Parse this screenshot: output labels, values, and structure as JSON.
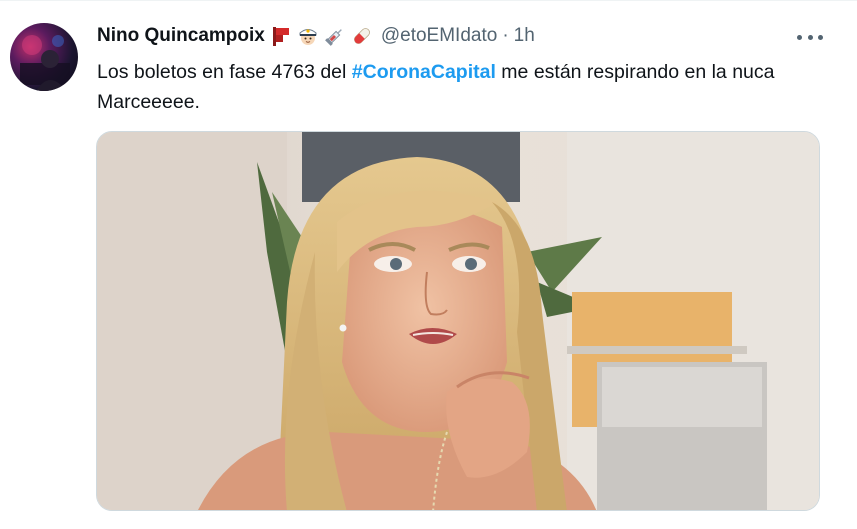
{
  "tweet": {
    "author": {
      "display_name": "Nino Quincampoix",
      "handle": "@etoEMIdato",
      "separator": "·",
      "time": "1h",
      "name_emojis": [
        "pennant-icon",
        "police-officer-icon",
        "syringe-icon",
        "pill-icon"
      ]
    },
    "text": {
      "before_hashtag": "Los boletos en fase 4763 del ",
      "hashtag": "#CoronaCapital",
      "after_hashtag": " me están respirando en la nuca Marceeeee."
    },
    "more_icon": "more-horizontal-icon",
    "media_type": "gif-image"
  },
  "colors": {
    "link": "#1d9bf0",
    "secondary_text": "#536471",
    "primary_text": "#0f1419"
  }
}
